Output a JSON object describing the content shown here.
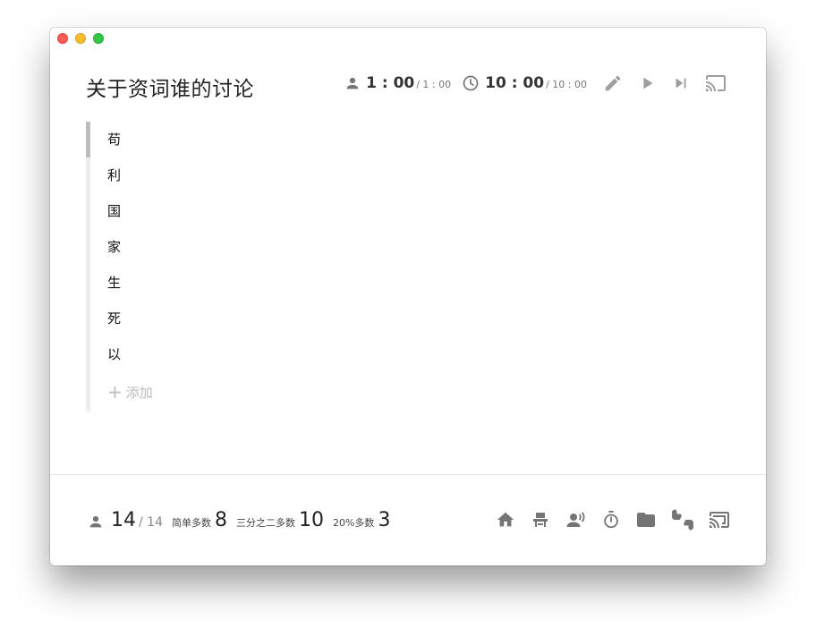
{
  "window": {
    "title": "关于资词谁的讨论"
  },
  "header": {
    "speaker_timer": {
      "current": "1 : 00",
      "total": "/ 1 : 00"
    },
    "session_timer": {
      "current": "10 : 00",
      "total": "/ 10 : 00"
    },
    "icons": [
      "person-icon",
      "clock-icon",
      "edit-icon",
      "play-icon",
      "skip-next-icon",
      "cast-icon"
    ]
  },
  "speakers": {
    "items": [
      "苟",
      "利",
      "国",
      "家",
      "生",
      "死",
      "以"
    ],
    "active_index": 0,
    "add_label": "添加"
  },
  "footer": {
    "present": "14",
    "total": "/ 14",
    "simple_majority_label": "简单多数",
    "simple_majority_value": "8",
    "two_thirds_label": "三分之二多数",
    "two_thirds_value": "10",
    "twenty_percent_label": "20%多数",
    "twenty_percent_value": "3",
    "icons": [
      "home-icon",
      "seat-icon",
      "speaker-icon",
      "stopwatch-icon",
      "folder-icon",
      "vote-icon",
      "cast-icon"
    ]
  },
  "colors": {
    "icon_gray": "#757575",
    "icon_light": "#9e9e9e",
    "accent_bar": "#bdbdbd"
  }
}
